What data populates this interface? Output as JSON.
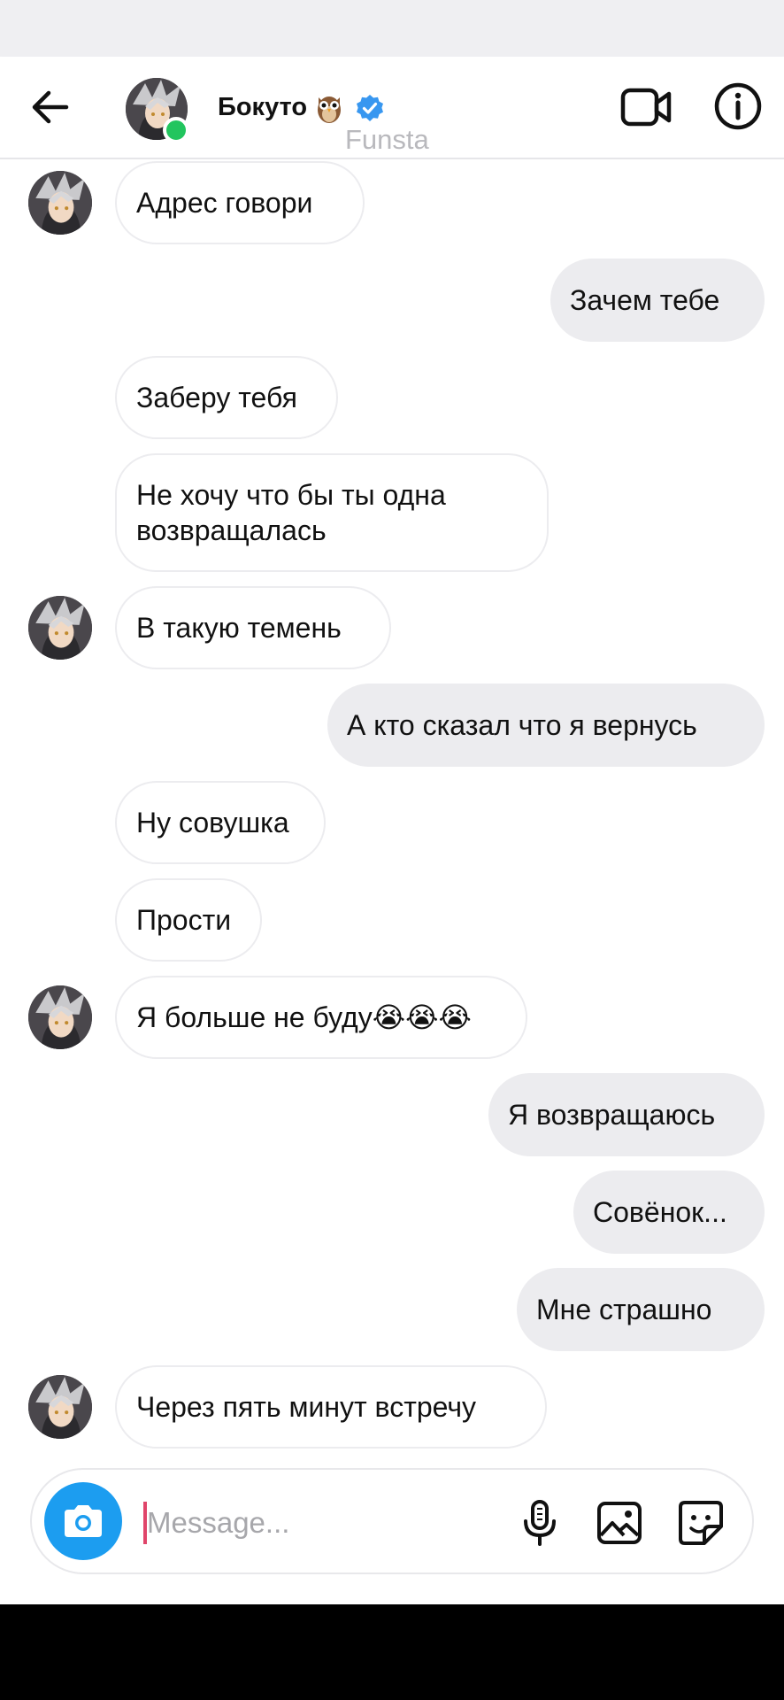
{
  "header": {
    "contact_name": "Бокуто",
    "watermark": "Funsta",
    "icons": {
      "back": "arrow-left-icon",
      "owl": "owl-emoji-icon",
      "verified": "verified-badge-icon",
      "video": "video-call-icon",
      "info": "info-icon"
    }
  },
  "messages": [
    {
      "side": "in",
      "text": "Адрес говори",
      "avatar": true
    },
    {
      "side": "out",
      "text": "Зачем тебе"
    },
    {
      "side": "in",
      "text": "Заберу тебя"
    },
    {
      "side": "in",
      "text": "Не хочу что бы ты одна возвращалась"
    },
    {
      "side": "in",
      "text": "В такую темень",
      "avatar": true
    },
    {
      "side": "out",
      "text": "А кто сказал что я вернусь"
    },
    {
      "side": "in",
      "text": "Ну совушка"
    },
    {
      "side": "in",
      "text": "Прости"
    },
    {
      "side": "in",
      "text": "Я больше не буду😭😭😭",
      "avatar": true
    },
    {
      "side": "out",
      "text": "Я возвращаюсь"
    },
    {
      "side": "out",
      "text": "Совёнок..."
    },
    {
      "side": "out",
      "text": "Мне страшно"
    },
    {
      "side": "in",
      "text": "Через пять минут встречу",
      "avatar": true
    }
  ],
  "composer": {
    "placeholder": "Message...",
    "value": "",
    "icons": {
      "camera": "camera-icon",
      "mic": "microphone-icon",
      "gallery": "image-icon",
      "sticker": "sticker-icon"
    }
  },
  "colors": {
    "accent_blue": "#1c9df0",
    "online_green": "#22c55e",
    "outgoing_bubble": "#ececef",
    "caret": "#e0456a"
  }
}
